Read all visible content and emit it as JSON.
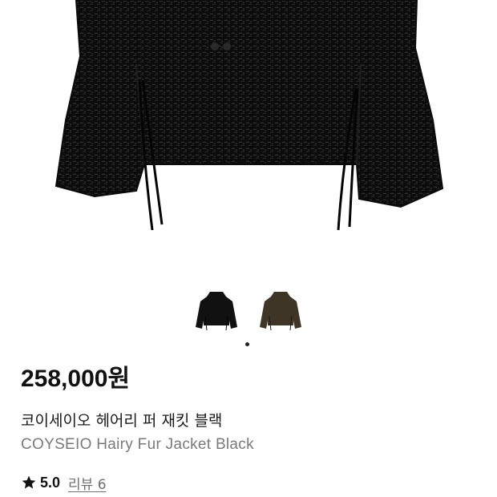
{
  "product": {
    "price": "258,000원",
    "name_kr": "코이세이오 헤어리 퍼 재킷 블랙",
    "name_en": "COYSEIO Hairy Fur Jacket Black",
    "rating": "5.0",
    "review_link": "리뷰 6"
  },
  "gallery": {
    "thumbnails": [
      {
        "variant": "black",
        "color": "#111111"
      },
      {
        "variant": "brown",
        "color": "#3e3526"
      }
    ],
    "active_index": 0
  },
  "icons": {
    "star": "star-icon"
  },
  "colors": {
    "jacket_black": "#0d0d0d",
    "jacket_brown": "#3e3526",
    "price_text": "#111111",
    "secondary_text": "#7a7a7a"
  }
}
